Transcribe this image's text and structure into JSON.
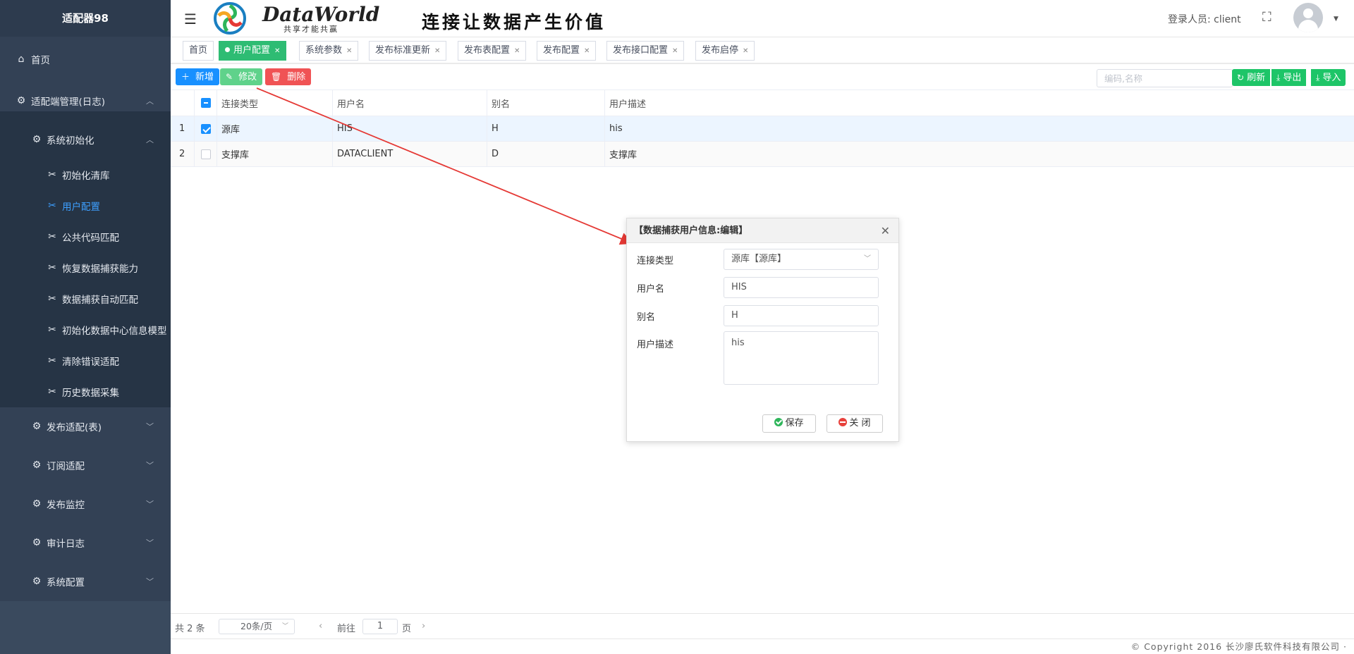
{
  "app": {
    "title": "适配器98"
  },
  "sidebar": {
    "home": "首页",
    "group1": "适配端管理(日志)",
    "sub1": "系统初始化",
    "sub_items": [
      "初始化清库",
      "用户配置",
      "公共代码匹配",
      "恢复数据捕获能力",
      "数据捕获自动匹配",
      "初始化数据中心信息模型",
      "清除错误适配",
      "历史数据采集"
    ],
    "active_item": "用户配置",
    "groups": [
      "发布适配(表)",
      "订阅适配",
      "发布监控",
      "审计日志",
      "系统配置"
    ]
  },
  "header": {
    "brand": "DataWorld",
    "brand_sub": "共享才能共赢",
    "slogan": "连接让数据产生价值",
    "user_label": "登录人员: client"
  },
  "tabs": [
    {
      "label": "首页",
      "active": false,
      "closable": false
    },
    {
      "label": "用户配置",
      "active": true,
      "closable": true
    },
    {
      "label": "系统参数",
      "active": false,
      "closable": true
    },
    {
      "label": "发布标准更新",
      "active": false,
      "closable": true
    },
    {
      "label": "发布表配置",
      "active": false,
      "closable": true
    },
    {
      "label": "发布配置",
      "active": false,
      "closable": true
    },
    {
      "label": "发布接口配置",
      "active": false,
      "closable": true
    },
    {
      "label": "发布启停",
      "active": false,
      "closable": true
    }
  ],
  "toolbar": {
    "add": "新增",
    "edit": "修改",
    "delete": "删除",
    "search_placeholder": "编码,名称",
    "refresh": "刷新",
    "export": "导出",
    "import": "导入"
  },
  "table": {
    "columns": [
      "连接类型",
      "用户名",
      "别名",
      "用户描述"
    ],
    "rows": [
      {
        "index": "1",
        "checked": true,
        "cells": [
          "源库",
          "HIS",
          "H",
          "his"
        ]
      },
      {
        "index": "2",
        "checked": false,
        "cells": [
          "支撑库",
          "DATACLIENT",
          "D",
          "支撑库"
        ]
      }
    ]
  },
  "pager": {
    "total": "共 2 条",
    "page_size": "20条/页",
    "goto": "前往",
    "page": "1",
    "page_unit": "页"
  },
  "footer": {
    "copyright": "© Copyright 2016 长沙廖氏软件科技有限公司 ·"
  },
  "dialog": {
    "title": "【数据捕获用户信息:编辑】",
    "fields": {
      "type_label": "连接类型",
      "type_value": "源库【源库】",
      "user_label": "用户名",
      "user_value": "HIS",
      "alias_label": "别名",
      "alias_value": "H",
      "desc_label": "用户描述",
      "desc_value": "his"
    },
    "save": "保存",
    "close": "关 闭"
  },
  "colors": {
    "sidebar": "#334155",
    "accent_green": "#2ebc73",
    "primary_blue": "#1890ff",
    "danger_red": "#f05355",
    "annotation_arrow": "#e53935"
  },
  "icons": [
    "home-icon",
    "gear-icon",
    "tools-icon",
    "chevron-up-icon",
    "chevron-down-icon",
    "menu-toggle-icon",
    "fullscreen-icon",
    "avatar-icon",
    "plus-icon",
    "edit-icon",
    "trash-icon",
    "refresh-icon",
    "download-icon",
    "close-icon",
    "check-circle-icon",
    "minus-circle-icon"
  ]
}
